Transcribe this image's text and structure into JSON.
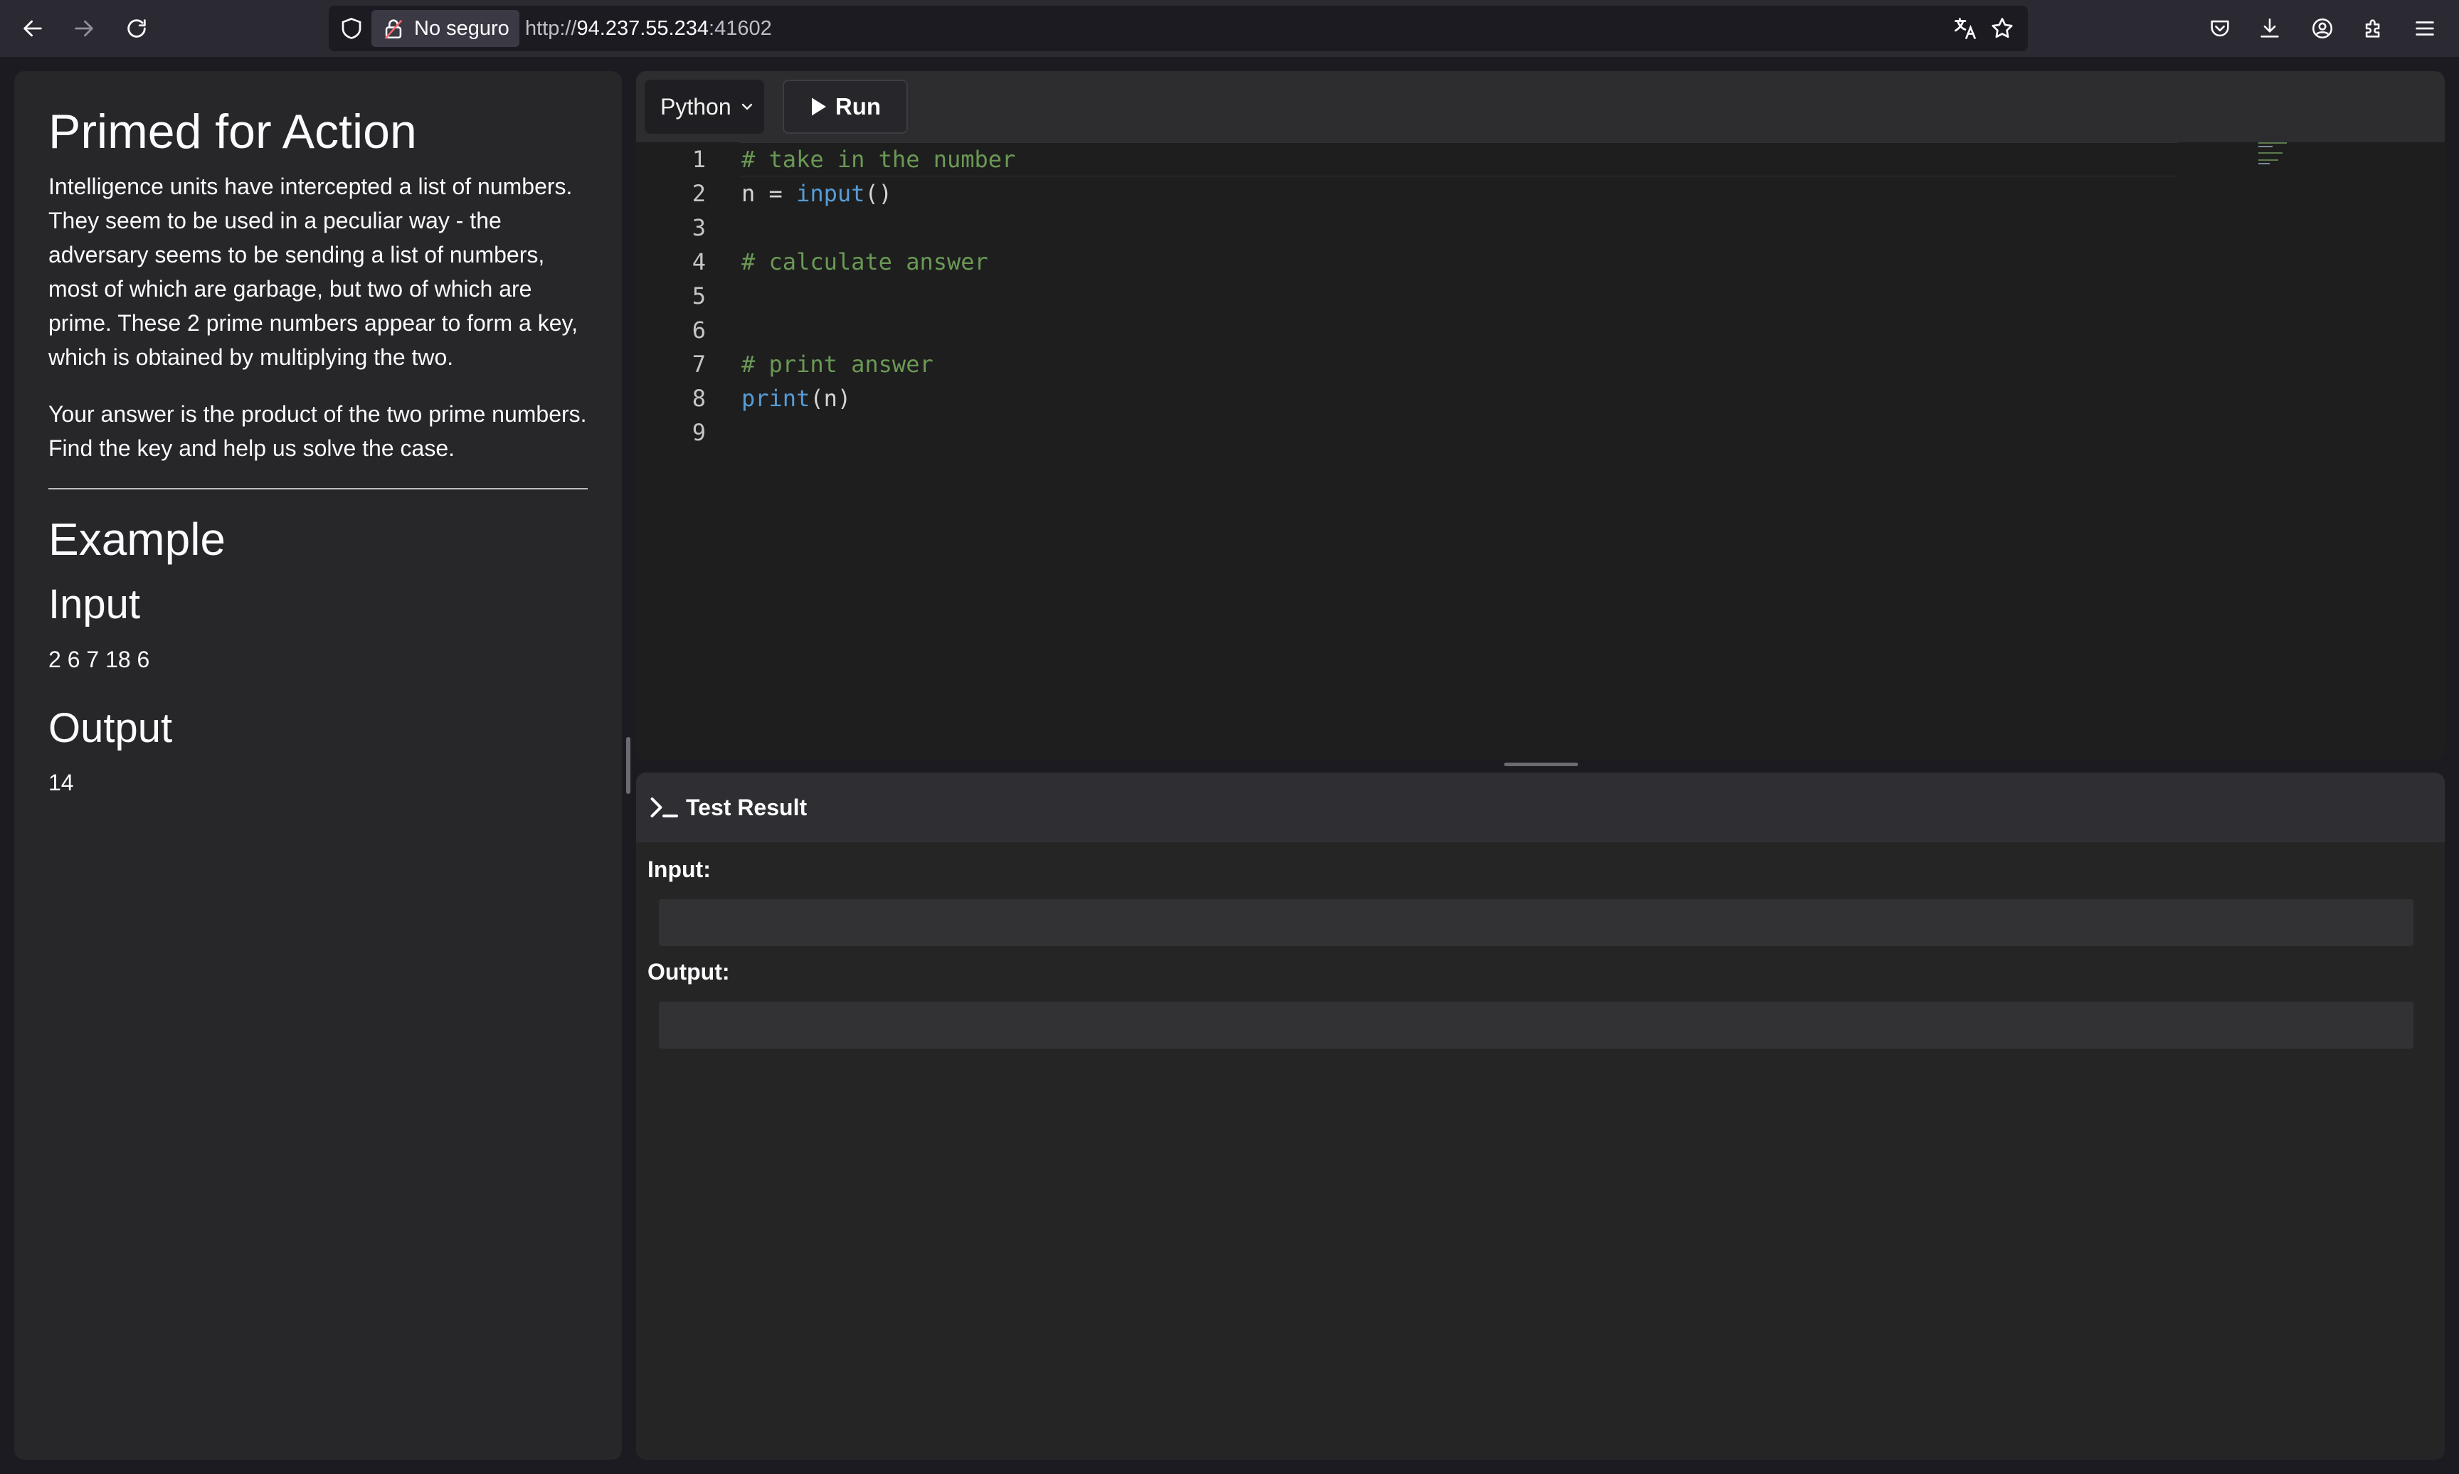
{
  "browser": {
    "security_label": "No seguro",
    "url_scheme": "http://",
    "url_host": "94.237.55.234",
    "url_port": ":41602",
    "icons": [
      "back-icon",
      "forward-icon",
      "reload-icon",
      "shield-icon",
      "insecure-lock-icon",
      "translate-icon",
      "bookmark-star-icon",
      "pocket-icon",
      "download-icon",
      "account-icon",
      "extensions-icon",
      "menu-icon"
    ]
  },
  "problem": {
    "title": "Primed for Action",
    "paragraph1": "Intelligence units have intercepted a list of numbers. They seem to be used in a peculiar way - the adversary seems to be sending a list of numbers, most of which are garbage, but two of which are prime. These 2 prime numbers appear to form a key, which is obtained by multiplying the two.",
    "paragraph2": "Your answer is the product of the two prime numbers. Find the key and help us solve the case.",
    "example_heading": "Example",
    "input_heading": "Input",
    "input_value": "2 6 7 18 6",
    "output_heading": "Output",
    "output_value": "14"
  },
  "editor": {
    "language": "Python",
    "run_label": "Run",
    "lines": [
      {
        "num": "1",
        "text": "# take in the number"
      },
      {
        "num": "2",
        "text": "n = input()"
      },
      {
        "num": "3",
        "text": ""
      },
      {
        "num": "4",
        "text": "# calculate answer"
      },
      {
        "num": "5",
        "text": ""
      },
      {
        "num": "6",
        "text": ""
      },
      {
        "num": "7",
        "text": "# print answer"
      },
      {
        "num": "8",
        "text": "print(n)"
      },
      {
        "num": "9",
        "text": ""
      }
    ],
    "colors": {
      "comment": "#6a9955",
      "builtin": "#569cd6",
      "text": "#d4d4d4"
    }
  },
  "result": {
    "title": "Test Result",
    "input_label": "Input:",
    "input_value": "",
    "output_label": "Output:",
    "output_value": ""
  }
}
